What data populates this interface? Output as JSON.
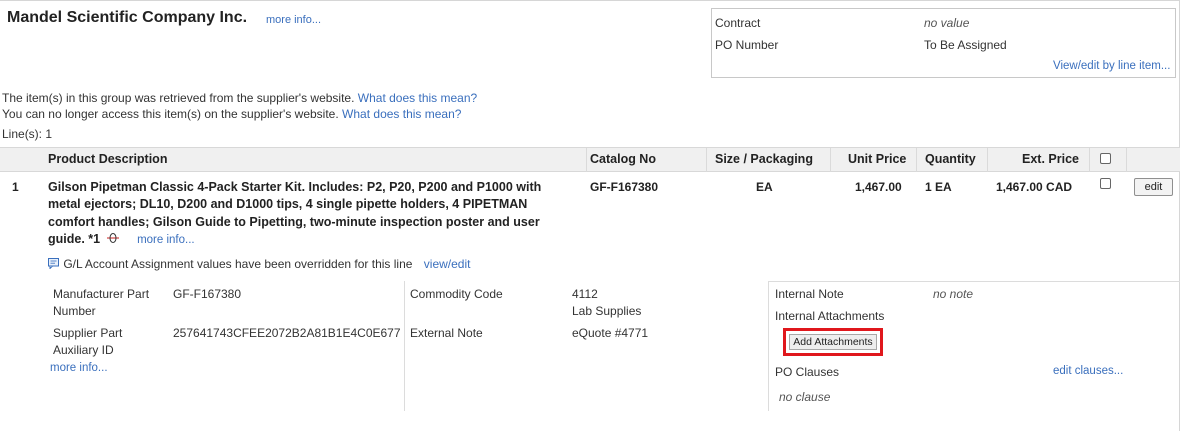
{
  "supplier": {
    "name": "Mandel Scientific Company Inc.",
    "more_info": "more info..."
  },
  "contract_box": {
    "contract_label": "Contract",
    "contract_value": "no value",
    "po_label": "PO Number",
    "po_value": "To Be Assigned",
    "view_edit_link": "View/edit by line item..."
  },
  "notices": {
    "line1_text": "The item(s) in this group was retrieved from the supplier's website.",
    "line1_link": "What does this mean?",
    "line2_text": "You can no longer access this item(s) on the supplier's website.",
    "line2_link": "What does this mean?",
    "lines_count": "Line(s): 1"
  },
  "table": {
    "headers": {
      "product_description": "Product Description",
      "catalog_no": "Catalog No",
      "size_packaging": "Size / Packaging",
      "unit_price": "Unit Price",
      "quantity": "Quantity",
      "ext_price": "Ext. Price"
    },
    "row": {
      "line_no": "1",
      "description": "Gilson Pipetman Classic 4-Pack Starter Kit. Includes: P2, P20, P200 and P1000 with metal ejectors; DL10, D200 and D1000 tips, 4 single pipette holders, 4 PIPETMAN comfort handles; Gilson Guide to Pipetting, two-minute inspection poster and user guide. *1",
      "more_info": "more info...",
      "catalog_no": "GF-F167380",
      "size_packaging": "EA",
      "unit_price": "1,467.00",
      "quantity": "1 EA",
      "ext_price": "1,467.00 CAD",
      "edit_label": "edit"
    }
  },
  "gl_notice": {
    "text": "G/L Account Assignment values have been overridden for this line",
    "link": "view/edit"
  },
  "details": {
    "mfr_part_label_1": "Manufacturer Part",
    "mfr_part_label_2": "Number",
    "mfr_part_value": "GF-F167380",
    "supplier_aux_label_1": "Supplier Part",
    "supplier_aux_label_2": "Auxiliary ID",
    "supplier_aux_value": "257641743CFEE2072B2A81B1E4C0E677",
    "more_info": "more info...",
    "commodity_label": "Commodity Code",
    "commodity_value_1": "4112",
    "commodity_value_2": "Lab Supplies",
    "external_note_label": "External Note",
    "external_note_value": "eQuote #4771",
    "internal_note_label": "Internal Note",
    "internal_note_value": "no note",
    "internal_attachments_label": "Internal Attachments",
    "add_attachments_label": "Add Attachments",
    "po_clauses_label": "PO Clauses",
    "edit_clauses_link": "edit clauses...",
    "no_clause": "no clause"
  },
  "colors": {
    "link": "#3a6fbd",
    "highlight_border": "#e0171c",
    "header_bg": "#f0f0f0"
  }
}
